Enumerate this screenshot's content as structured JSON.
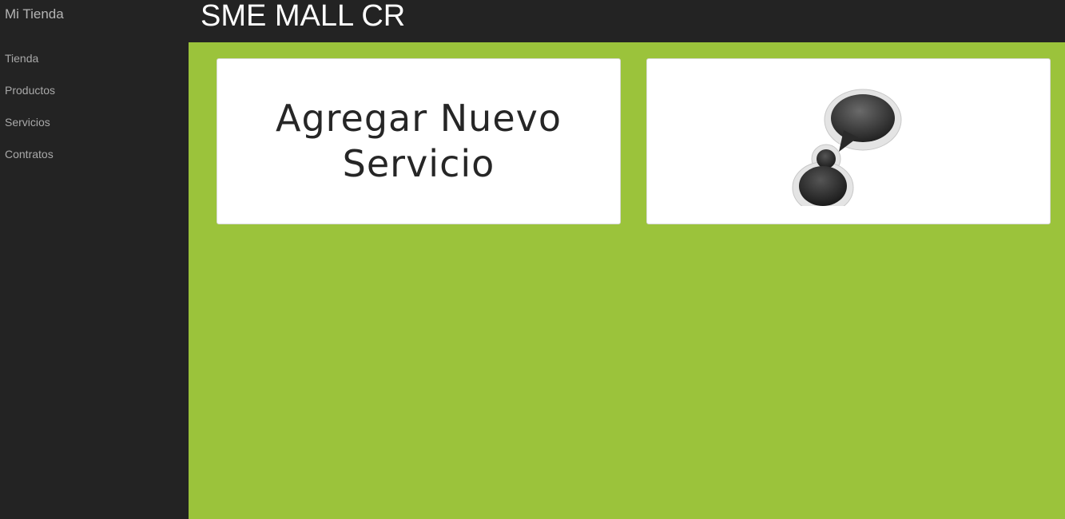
{
  "sidebar": {
    "brand": "Mi Tienda",
    "items": [
      {
        "label": "Tienda"
      },
      {
        "label": "Productos"
      },
      {
        "label": "Servicios"
      },
      {
        "label": "Contratos"
      }
    ]
  },
  "header": {
    "title": "SME MALL CR"
  },
  "cards": {
    "add_service": {
      "line1": "Agregar Nuevo",
      "line2": "Servicio"
    },
    "chat": {
      "icon": "chat-user-icon"
    }
  },
  "colors": {
    "sidebar_bg": "#232323",
    "main_bg": "#9bc33b",
    "card_bg": "#ffffff",
    "title_text": "#ffffff"
  }
}
